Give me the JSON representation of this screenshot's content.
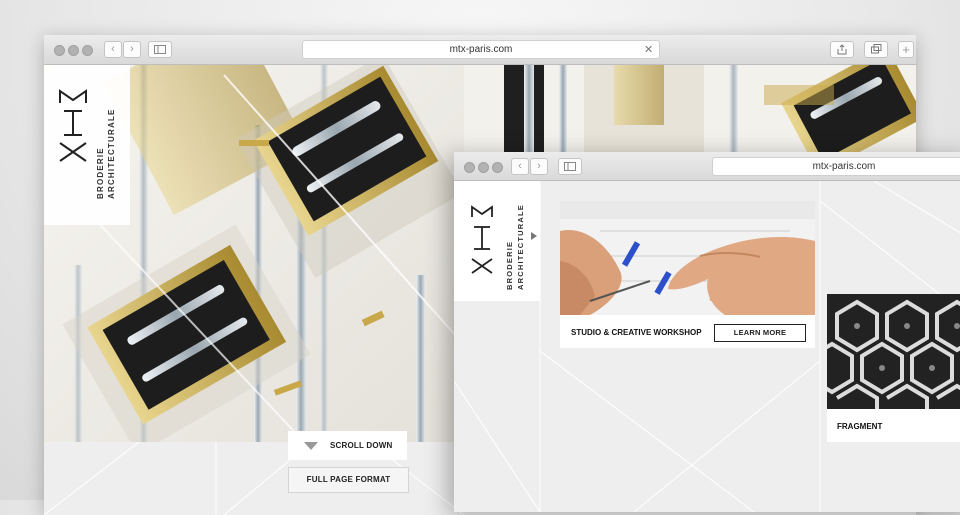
{
  "back_window": {
    "url": "mtx-paris.com",
    "logo_text": "MTX",
    "tagline_line1": "BRODERIE",
    "tagline_line2": "ARCHITECTURALE",
    "scroll_down_label": "SCROLL DOWN",
    "full_page_label": "FULL PAGE FORMAT",
    "plus_tab_label": "+"
  },
  "front_window": {
    "url": "mtx-paris.com",
    "logo_text": "MTX",
    "tagline_line1": "BRODERIE",
    "tagline_line2": "ARCHITECTURALE",
    "card1_title": "STUDIO & CREATIVE WORKSHOP",
    "card1_button": "LEARN MORE",
    "card2_title": "FRAGMENT"
  },
  "colors": {
    "brass": "#c9a84a",
    "black_panel": "#1c1c1c",
    "background": "#eeeeee"
  }
}
